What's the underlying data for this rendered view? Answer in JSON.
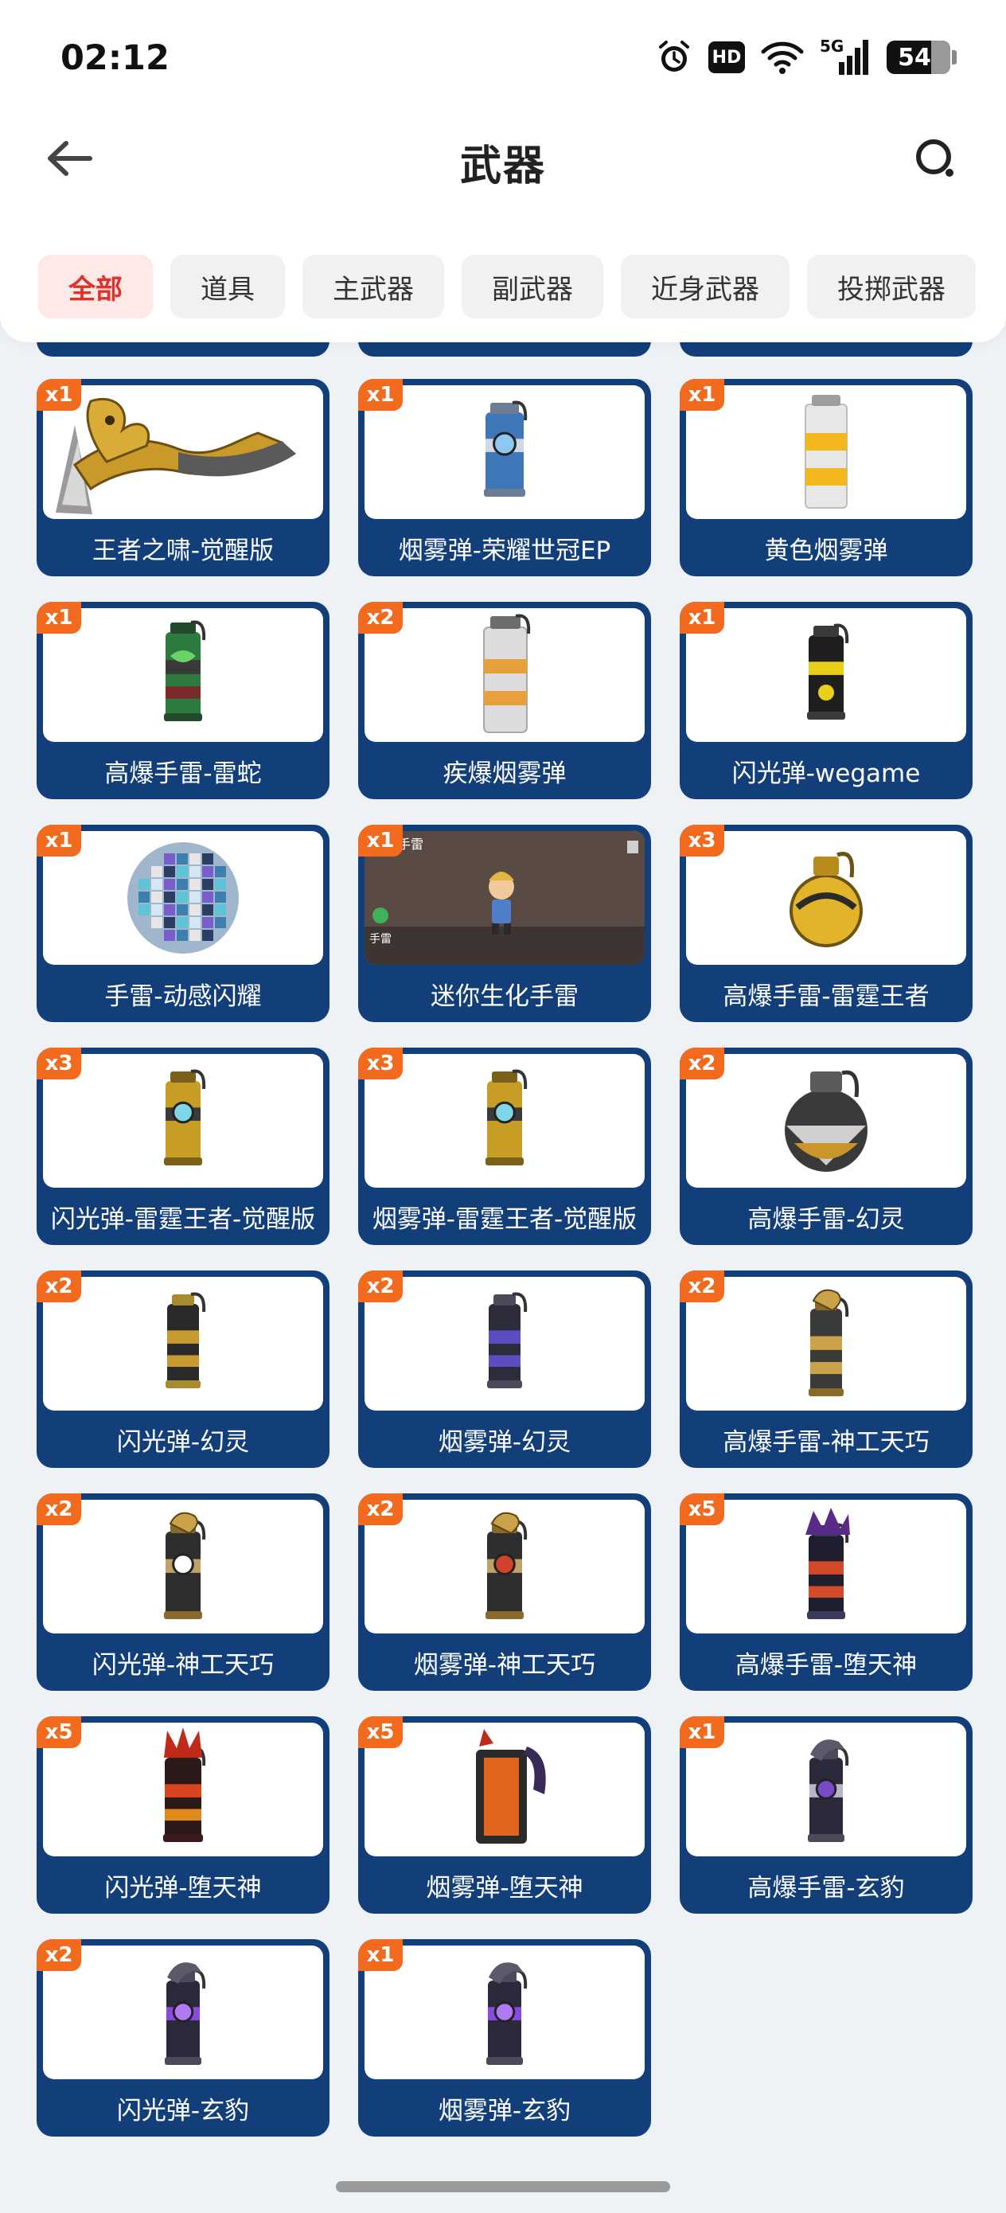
{
  "status_bar": {
    "time": "02:12",
    "icons": [
      "alarm-icon",
      "hd-icon",
      "wifi-icon",
      "5g-signal-icon",
      "battery-icon"
    ],
    "hd_label": "HD",
    "network_label": "5G",
    "battery_level": "54"
  },
  "header": {
    "title": "武器",
    "back_icon": "back-arrow-icon",
    "search_icon": "search-icon"
  },
  "tabs": [
    {
      "label": "全部",
      "active": true
    },
    {
      "label": "道具",
      "active": false
    },
    {
      "label": "主武器",
      "active": false
    },
    {
      "label": "副武器",
      "active": false
    },
    {
      "label": "近身武器",
      "active": false
    },
    {
      "label": "投掷武器",
      "active": false
    }
  ],
  "colors": {
    "card_bg": "#123f7a",
    "badge_bg": "#f26a1d",
    "active_tab_text": "#e2302a",
    "active_tab_bg": "#fde9e6"
  },
  "items": [
    {
      "name": "王者之啸-觉醒版",
      "qty": "x1",
      "art": "gold-dragon-axe"
    },
    {
      "name": "烟雾弹-荣耀世冠EP",
      "qty": "x1",
      "art": "blue-smoke-grenade"
    },
    {
      "name": "黄色烟雾弹",
      "qty": "x1",
      "art": "yellow-striped-canister"
    },
    {
      "name": "高爆手雷-雷蛇",
      "qty": "x1",
      "art": "green-razer-grenade"
    },
    {
      "name": "疾爆烟雾弹",
      "qty": "x2",
      "art": "orange-striped-canister"
    },
    {
      "name": "闪光弹-wegame",
      "qty": "x1",
      "art": "black-yellow-flash"
    },
    {
      "name": "手雷-动感闪耀",
      "qty": "x1",
      "art": "disco-ball-grenade"
    },
    {
      "name": "迷你生化手雷",
      "qty": "x1",
      "art": "mini-biochem-screenshot",
      "screenshot_labels": [
        "化手雷",
        "手雷"
      ]
    },
    {
      "name": "高爆手雷-雷霆王者",
      "qty": "x3",
      "art": "gold-thunder-grenade"
    },
    {
      "name": "闪光弹-雷霆王者-觉醒版",
      "qty": "x3",
      "art": "gold-thunder-flash"
    },
    {
      "name": "烟雾弹-雷霆王者-觉醒版",
      "qty": "x3",
      "art": "gold-thunder-smoke"
    },
    {
      "name": "高爆手雷-幻灵",
      "qty": "x2",
      "art": "phantom-round-grenade"
    },
    {
      "name": "闪光弹-幻灵",
      "qty": "x2",
      "art": "phantom-gold-flash"
    },
    {
      "name": "烟雾弹-幻灵",
      "qty": "x2",
      "art": "phantom-purple-smoke"
    },
    {
      "name": "高爆手雷-神工天巧",
      "qty": "x2",
      "art": "dragon-gold-grenade"
    },
    {
      "name": "闪光弹-神工天巧",
      "qty": "x2",
      "art": "dragon-eye-flash"
    },
    {
      "name": "烟雾弹-神工天巧",
      "qty": "x2",
      "art": "dragon-red-smoke"
    },
    {
      "name": "高爆手雷-堕天神",
      "qty": "x5",
      "art": "fallen-god-grenade"
    },
    {
      "name": "闪光弹-堕天神",
      "qty": "x5",
      "art": "fallen-god-flash"
    },
    {
      "name": "烟雾弹-堕天神",
      "qty": "x5",
      "art": "fallen-god-smoke"
    },
    {
      "name": "高爆手雷-玄豹",
      "qty": "x1",
      "art": "panther-grenade"
    },
    {
      "name": "闪光弹-玄豹",
      "qty": "x2",
      "art": "panther-flash"
    },
    {
      "name": "烟雾弹-玄豹",
      "qty": "x1",
      "art": "panther-smoke"
    }
  ]
}
